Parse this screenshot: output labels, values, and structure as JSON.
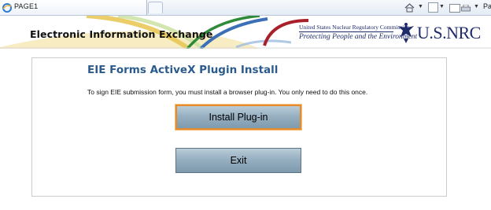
{
  "browser": {
    "tab_title": "PAGE1",
    "command_bar_label": "Pa"
  },
  "banner": {
    "title": "Electronic Information Exchange",
    "agency_line": "United States Nuclear Regulatory Commission",
    "tagline": "Protecting People and the Environment",
    "wordmark": "U.S.NRC"
  },
  "main": {
    "heading": "EIE Forms ActiveX Plugin Install",
    "instructions": "To sign EIE submission form, you must install a browser plug-in.  You only need to do this once.",
    "install_button": "Install Plug-in",
    "exit_button": "Exit"
  },
  "colors": {
    "heading": "#2a5b8c",
    "button_focus_border": "#e58b2c",
    "agency_blue": "#1f2b6b"
  }
}
